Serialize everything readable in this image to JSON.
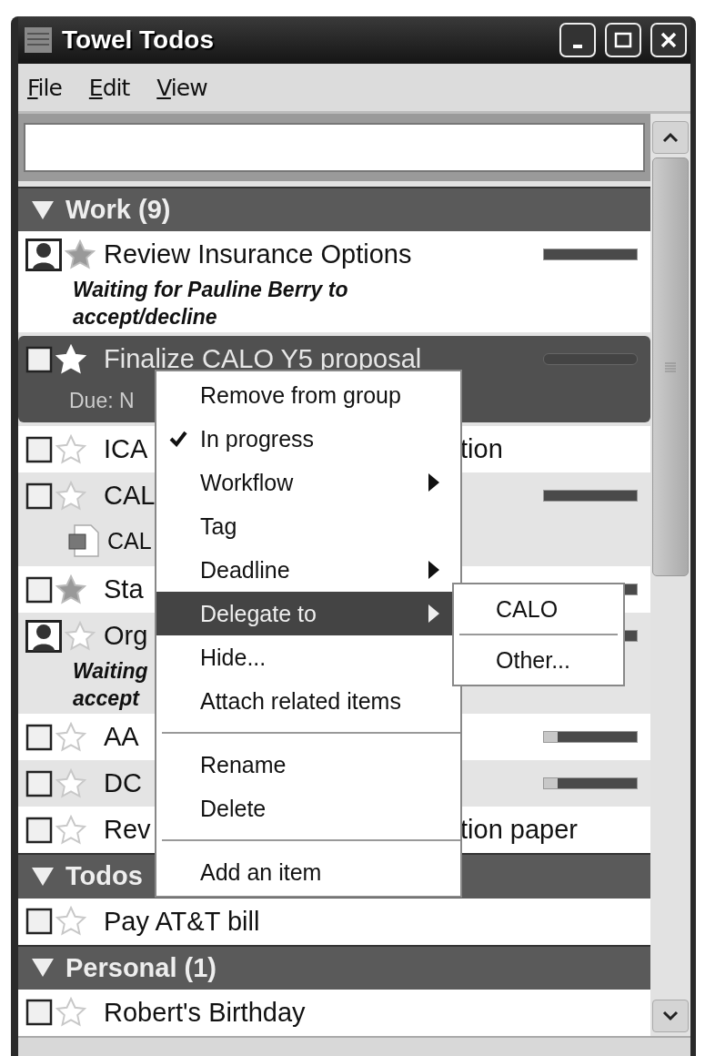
{
  "window": {
    "title": "Towel Todos"
  },
  "menu_bar": [
    {
      "label": "File"
    },
    {
      "label": "Edit"
    },
    {
      "label": "View"
    }
  ],
  "groups": [
    {
      "name": "Work (9)",
      "expanded": true,
      "items": [
        {
          "kind": "delegated",
          "starred": true,
          "selected": false,
          "title": "Review Insurance Options",
          "level": 1,
          "note_lines": [
            "Waiting for Pauline Berry to",
            "accept/decline"
          ]
        },
        {
          "kind": "task",
          "checked": false,
          "starred": true,
          "selected": true,
          "title": "Finalize CALO Y5 proposal",
          "level": 0,
          "due": "Due: N"
        },
        {
          "kind": "task",
          "checked": false,
          "starred": false,
          "selected": false,
          "title": "ICA",
          "title_tail": "tion"
        },
        {
          "kind": "task",
          "checked": false,
          "starred": false,
          "selected": false,
          "title": "CAL",
          "level": 1,
          "attachment": "CAL"
        },
        {
          "kind": "task",
          "checked": false,
          "starred": true,
          "selected": false,
          "title": "Sta",
          "level": 1
        },
        {
          "kind": "delegated",
          "starred": false,
          "selected": false,
          "title": "Org",
          "level": 1,
          "note_lines": [
            "Waiting",
            "accept"
          ]
        },
        {
          "kind": "task",
          "checked": false,
          "starred": false,
          "selected": false,
          "title": "AA",
          "level": 0.85
        },
        {
          "kind": "task",
          "checked": false,
          "starred": false,
          "selected": false,
          "title": "DC",
          "level": 0.85
        },
        {
          "kind": "task",
          "checked": false,
          "starred": false,
          "selected": false,
          "title": "Rev",
          "title_tail": "tion paper"
        }
      ]
    },
    {
      "name": "Todos",
      "expanded": true,
      "items": [
        {
          "kind": "task",
          "checked": false,
          "starred": false,
          "selected": false,
          "title": "Pay AT&T bill"
        }
      ]
    },
    {
      "name": "Personal (1)",
      "expanded": true,
      "items": [
        {
          "kind": "task",
          "checked": false,
          "starred": false,
          "selected": false,
          "title": "Robert's Birthday"
        }
      ]
    }
  ],
  "context_menu": {
    "items": [
      {
        "kind": "item",
        "label": "Remove from group",
        "checked": false,
        "submenu": false,
        "selected": false
      },
      {
        "kind": "item",
        "label": "In progress",
        "checked": true,
        "submenu": false,
        "selected": false
      },
      {
        "kind": "item",
        "label": "Workflow",
        "checked": false,
        "submenu": true,
        "selected": false
      },
      {
        "kind": "item",
        "label": "Tag",
        "checked": false,
        "submenu": false,
        "selected": false
      },
      {
        "kind": "item",
        "label": "Deadline",
        "checked": false,
        "submenu": true,
        "selected": false
      },
      {
        "kind": "item",
        "label": "Delegate to",
        "checked": false,
        "submenu": true,
        "selected": true
      },
      {
        "kind": "item",
        "label": "Hide...",
        "checked": false,
        "submenu": false,
        "selected": false
      },
      {
        "kind": "item",
        "label": "Attach related items",
        "checked": false,
        "submenu": false,
        "selected": false
      },
      {
        "kind": "separator"
      },
      {
        "kind": "item",
        "label": "Rename",
        "checked": false,
        "submenu": false,
        "selected": false
      },
      {
        "kind": "item",
        "label": "Delete",
        "checked": false,
        "submenu": false,
        "selected": false
      },
      {
        "kind": "separator"
      },
      {
        "kind": "item",
        "label": "Add an item",
        "checked": false,
        "submenu": false,
        "selected": false
      }
    ]
  },
  "submenu": {
    "items": [
      {
        "kind": "item",
        "label": "CALO"
      },
      {
        "kind": "separator"
      },
      {
        "kind": "item",
        "label": "Other..."
      }
    ]
  }
}
